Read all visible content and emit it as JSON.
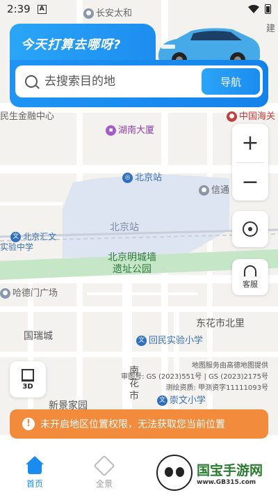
{
  "status_bar": {
    "time": "2:39",
    "a_badge": "A"
  },
  "header": {
    "promo_title": "今天打算去哪呀?",
    "search_placeholder": "去搜索目的地",
    "nav_label": "导航"
  },
  "map": {
    "pois": {
      "changan_taihe": "长安太和",
      "minsheng": "民生金融中心",
      "china_customs": "中国海关",
      "hunan_mansion": "湖南大厦",
      "beijing_station_metro": "北京站",
      "xintong": "信通",
      "beijing_huiwen": "北京汇文\n实验中学",
      "beijing_station_area": "北京站",
      "mingchengqiang": "北京明城墙\n遗址公园",
      "hademen": "哈德门广场",
      "dongcheng_beili": "东花市北里",
      "guoruicheng": "国瑞城",
      "huimin_school": "回民实验小学",
      "xinjing_home": "新景家园",
      "chongwen_school": "崇文小学",
      "nanhuashi": "南\n花\n市",
      "jian_edge": "建",
      "guo_edge": "国"
    },
    "credit": {
      "line1": "地图服务由高德地图提供",
      "line2": "审图号: GS (2023)551号 | GS (2023)2175号",
      "line3": "测绘资质: 甲测资字11111093号"
    }
  },
  "controls": {
    "zoom_in": "+",
    "zoom_out": "−",
    "service_label": "客服",
    "three_d_label": "3D"
  },
  "warning": {
    "icon": "!",
    "text": "未开启地区位置权限，无法获取您当前位置"
  },
  "bottom_nav": {
    "tabs": [
      {
        "label": "首页",
        "active": true
      },
      {
        "label": "全景",
        "active": false
      }
    ]
  },
  "watermark": {
    "title": "国宝手游网",
    "url": "www.GB315.com"
  },
  "colors": {
    "accent": "#1a8cf0",
    "warning": "#f28b3b",
    "map_bg": "#f4f2ee"
  }
}
